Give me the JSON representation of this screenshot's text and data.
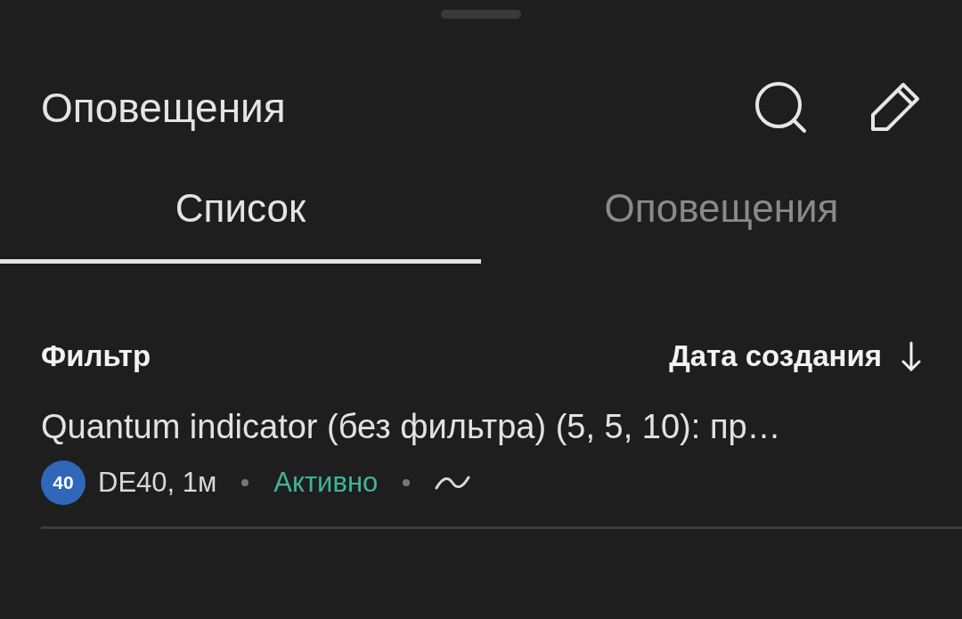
{
  "header": {
    "title": "Оповещения"
  },
  "tabs": [
    {
      "label": "Список",
      "selected": true
    },
    {
      "label": "Оповещения",
      "selected": false
    }
  ],
  "toolbar": {
    "filter": "Фильтр",
    "sort": "Дата создания"
  },
  "alerts": [
    {
      "title": "Quantum indicator (без фильтра) (5, 5, 10): пр…",
      "badge": {
        "text": "40",
        "color": "#3067b8"
      },
      "symbol": "DE40, 1м",
      "status": {
        "label": "Активно",
        "color": "#3fb59a"
      }
    }
  ]
}
